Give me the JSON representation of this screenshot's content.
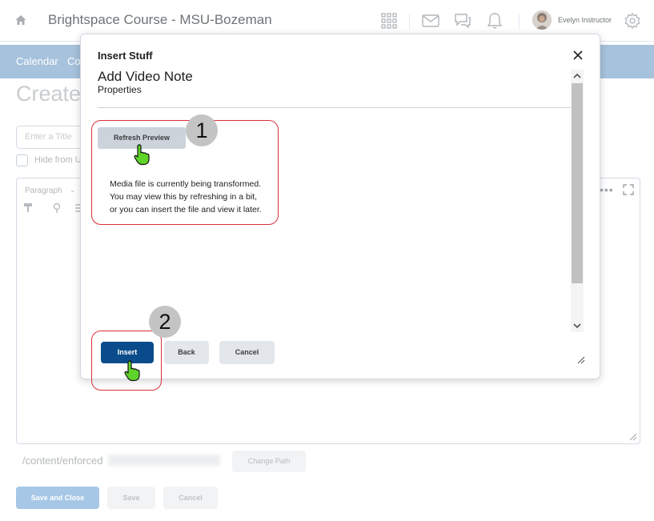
{
  "header": {
    "course_title": "Brightspace Course - MSU-Bozeman",
    "user_name": "Evelyn Instructor",
    "icons": [
      "home-icon",
      "grid-icon",
      "mail-icon",
      "chat-icon",
      "bell-icon",
      "gear-icon"
    ]
  },
  "nav": {
    "items": [
      {
        "label": "Calendar"
      },
      {
        "label": "Co"
      }
    ]
  },
  "page": {
    "heading": "Create",
    "title_placeholder": "Enter a Title",
    "hide_label": "Hide from U",
    "editor_format": "Paragraph",
    "path_label": "/content/enforced",
    "change_path_label": "Change Path",
    "save_close_label": "Save and Close",
    "save_label": "Save",
    "cancel_label": "Cancel"
  },
  "dialog": {
    "title": "Insert Stuff",
    "heading": "Add Video Note",
    "subheading": "Properties",
    "refresh_label": "Refresh Preview",
    "message_lines": [
      "Media file is currently being transformed.",
      "You may view this by refreshing in a bit,",
      "or you can insert the file and view it later."
    ],
    "insert_label": "Insert",
    "back_label": "Back",
    "cancel_label": "Cancel"
  },
  "annotations": {
    "step1": "1",
    "step2": "2",
    "highlight_color": "#d8313a",
    "pointer_color": "#5ed42a"
  },
  "colors": {
    "primary": "#0a4c8b",
    "nav_bar": "#a6c2dc",
    "secondary_button": "#e3e7ec"
  }
}
